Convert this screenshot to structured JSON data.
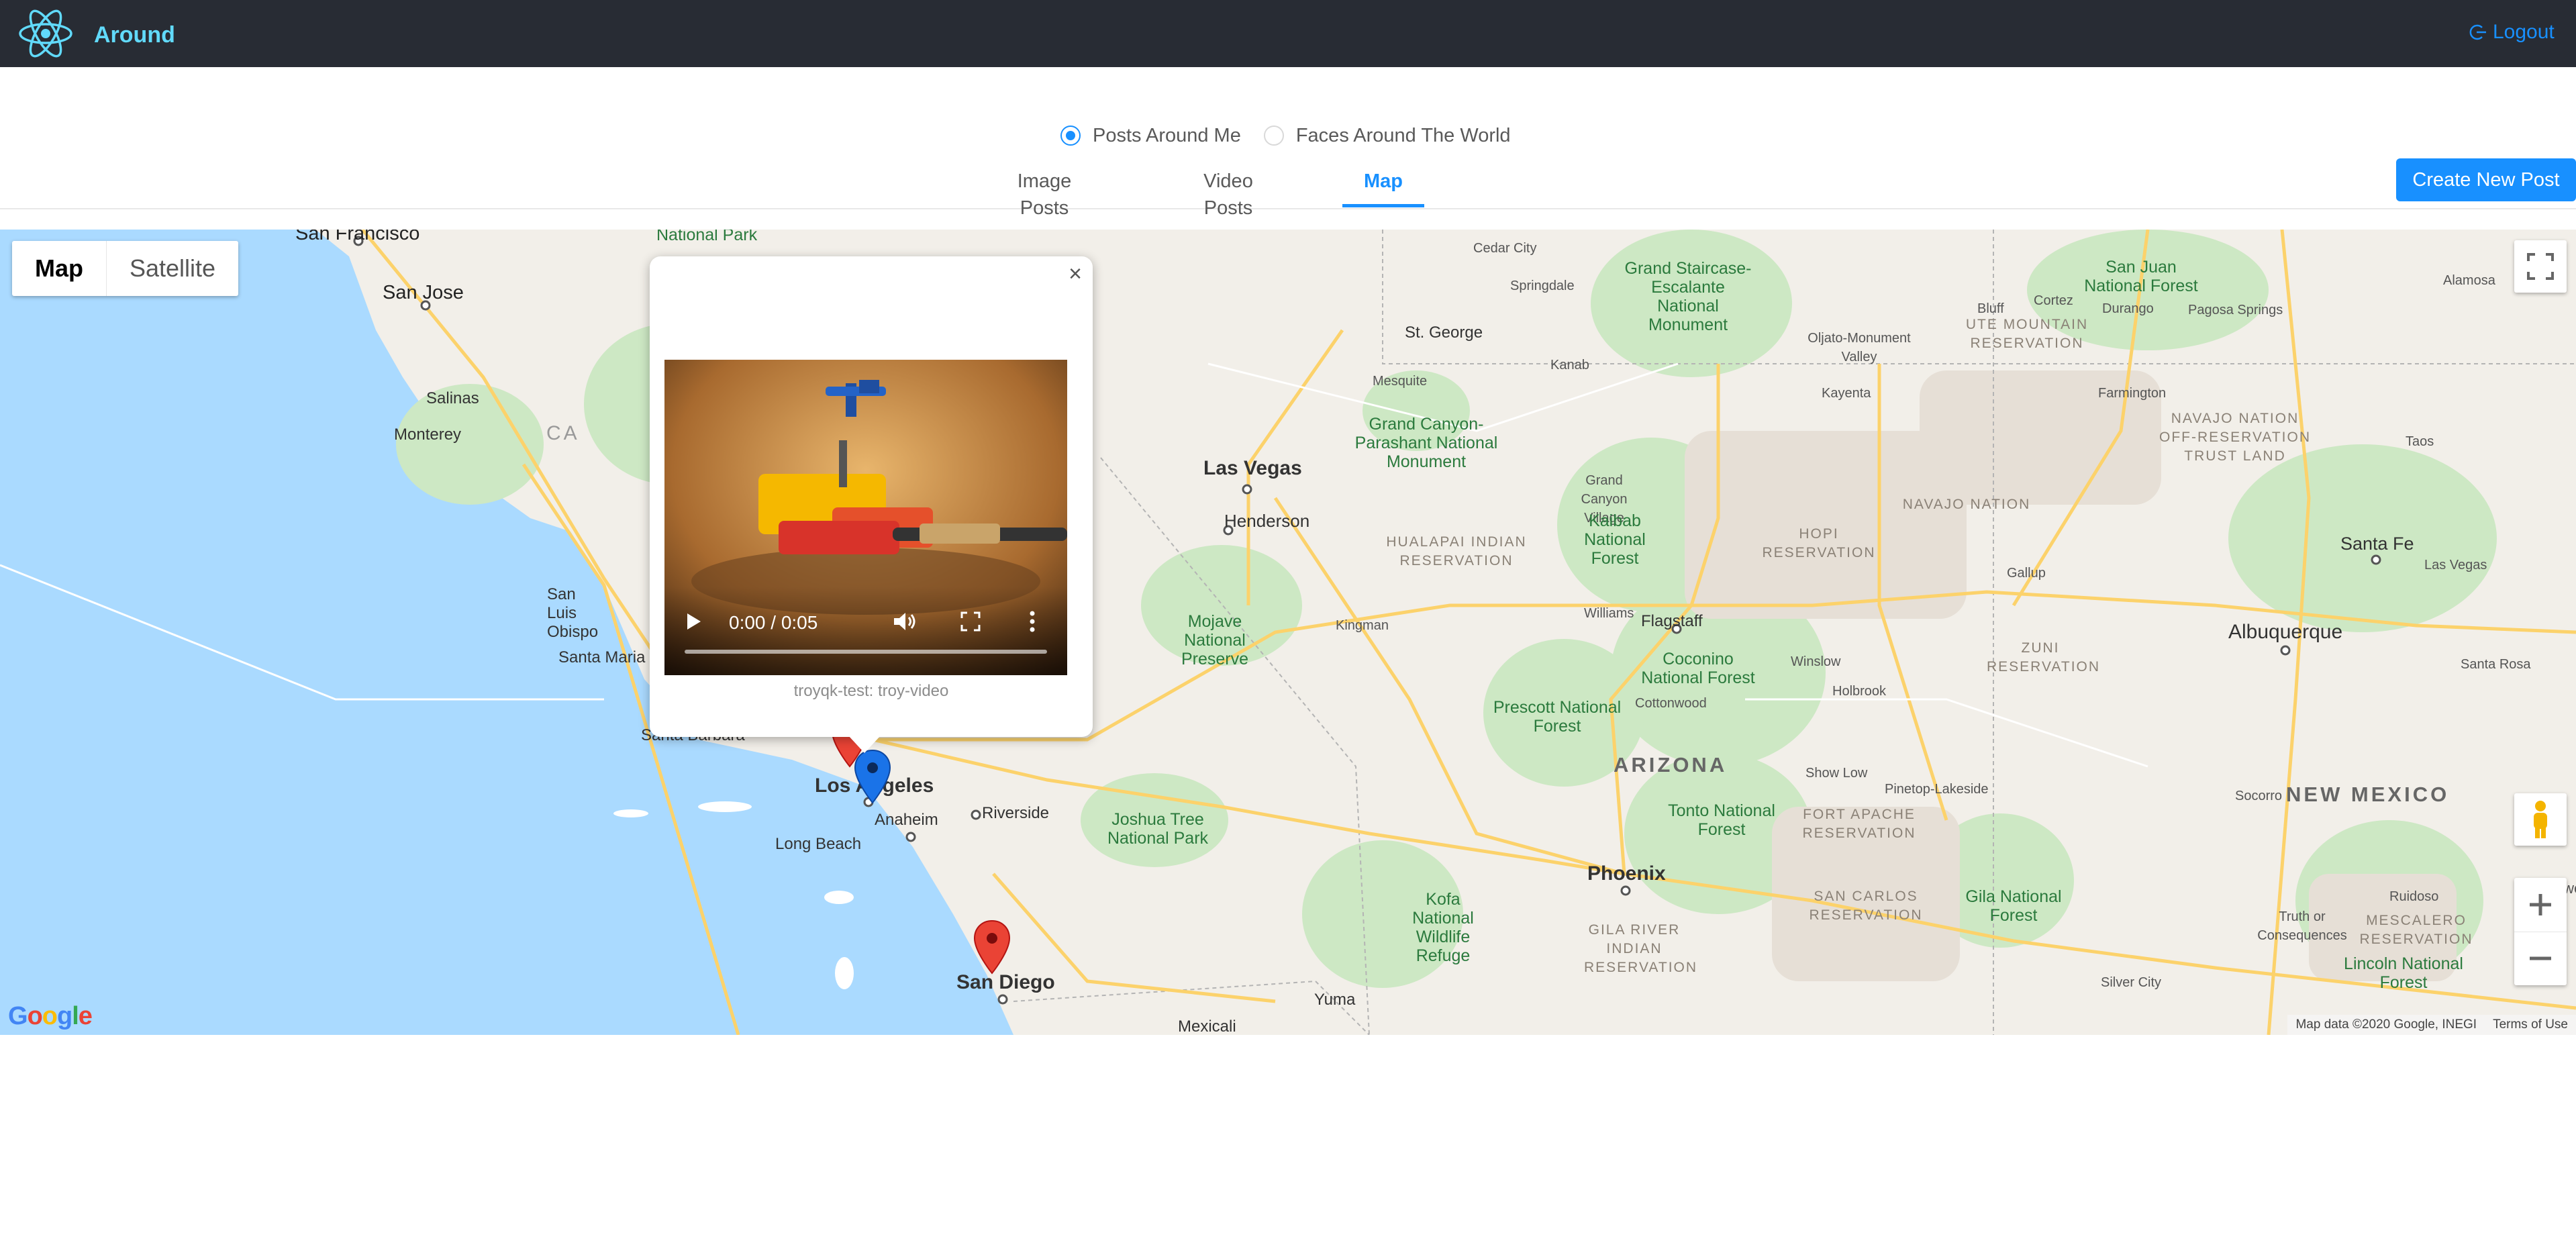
{
  "header": {
    "app_title": "Around",
    "logout_label": "Logout",
    "colors": {
      "background": "#282c34",
      "brand": "#61dafb",
      "link": "#1890ff"
    }
  },
  "filter": {
    "options": [
      {
        "label": "Posts Around Me",
        "checked": true
      },
      {
        "label": "Faces Around The World",
        "checked": false
      }
    ]
  },
  "tabs": {
    "items": [
      {
        "label": "Image Posts",
        "active": false
      },
      {
        "label": "Video Posts",
        "active": false
      },
      {
        "label": "Map",
        "active": true
      }
    ],
    "create_button_label": "Create New Post"
  },
  "map": {
    "map_types": [
      {
        "label": "Map",
        "active": true
      },
      {
        "label": "Satellite",
        "active": false
      }
    ],
    "labels": {
      "san_francisco": "San Francisco",
      "san_jose": "San Jose",
      "salinas": "Salinas",
      "monterey": "Monterey",
      "san_luis_obispo": "San Luis Obispo",
      "santa_maria": "Santa Maria",
      "santa_barbara": "Santa Barbara",
      "los_angeles": "Los Angeles",
      "anaheim": "Anaheim",
      "riverside": "Riverside",
      "long_beach": "Long Beach",
      "san_diego": "San Diego",
      "mexicali": "Mexicali",
      "yuma": "Yuma",
      "ca_partial": "CA",
      "las_vegas": "Las Vegas",
      "henderson": "Henderson",
      "kingman": "Kingman",
      "st_george": "St. George",
      "springdale": "Springdale",
      "kanab": "Kanab",
      "mesquite": "Mesquite",
      "cedar_city": "Cedar City",
      "national_park_top": "National Park",
      "mojave": "Mojave National Preserve",
      "joshua_tree": "Joshua Tree National Park",
      "grand_canyon_parashant": "Grand Canyon-Parashant National Monument",
      "hualapai": "HUALAPAI INDIAN RESERVATION",
      "grand_canyon_village": "Grand Canyon Village",
      "kaibab": "Kaibab National Forest",
      "grand_staircase": "Grand Staircase-Escalante National Monument",
      "williams": "Williams",
      "flagstaff": "Flagstaff",
      "coconino": "Coconino National Forest",
      "prescott": "Prescott National Forest",
      "cottonwood": "Cottonwood",
      "arizona": "ARIZONA",
      "phoenix": "Phoenix",
      "tonto": "Tonto National Forest",
      "fort_apache": "FORT APACHE RESERVATION",
      "san_carlos": "SAN CARLOS RESERVATION",
      "gila_river": "GILA RIVER INDIAN RESERVATION",
      "kofa": "Kofa National Wildlife Refuge",
      "winslow": "Winslow",
      "holbrook": "Holbrook",
      "show_low": "Show Low",
      "pinetop": "Pinetop-Lakeside",
      "hopi": "HOPI RESERVATION",
      "navajo_nation": "NAVAJO NATION",
      "navajo_offres": "NAVAJO NATION OFF-RESERVATION TRUST LAND",
      "ute": "UTE MOUNTAIN RESERVATION",
      "zuni": "ZUNI RESERVATION",
      "gila_forest": "Gila National Forest",
      "san_juan": "San Juan National Forest",
      "bluff": "Bluff",
      "cortez": "Cortez",
      "durango": "Durango",
      "pagosa": "Pagosa Springs",
      "alamosa": "Alamosa",
      "ojlato": "Oljato-Monument Valley",
      "kayenta": "Kayenta",
      "farmington": "Farmington",
      "gallup": "Gallup",
      "taos": "Taos",
      "santa_fe": "Santa Fe",
      "las_vegas_nm": "Las Vegas",
      "albuquerque": "Albuquerque",
      "santa_rosa": "Santa Rosa",
      "new_mexico": "NEW MEXICO",
      "socorro": "Socorro",
      "roswell": "Roswell",
      "ruidoso": "Ruidoso",
      "truth": "Truth or Consequences",
      "mescalero": "MESCALERO RESERVATION",
      "lincoln": "Lincoln National Forest",
      "silver_city": "Silver City"
    },
    "info_window": {
      "caption": "troyqk-test: troy-video",
      "video_time": "0:00 / 0:05"
    },
    "footer": {
      "map_data": "Map data ©2020 Google, INEGI",
      "terms": "Terms of Use"
    },
    "google_logo": "Google"
  }
}
